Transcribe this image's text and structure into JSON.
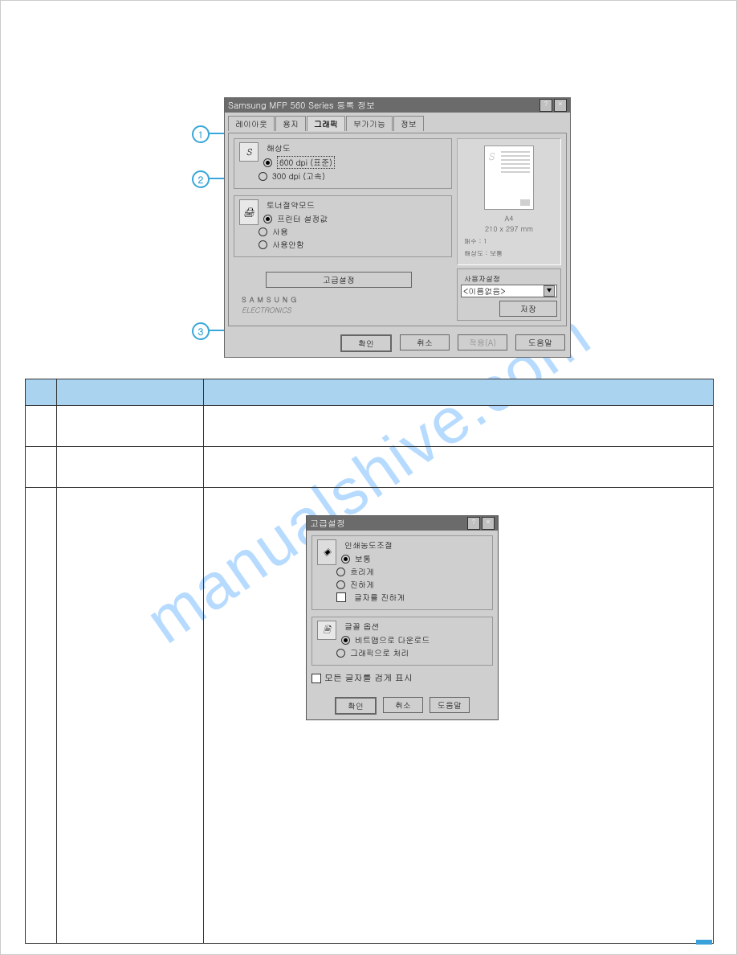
{
  "watermark": "manualshive.com",
  "dialog1": {
    "title": "Samsung MFP 560 Series 등록 정보",
    "tabs": [
      "레이아웃",
      "용지",
      "그래픽",
      "부가기능",
      "정보"
    ],
    "active_tab": 2,
    "resolution": {
      "legend": "해상도",
      "opt1": "600 dpi (표준)",
      "opt2": "300 dpi (고속)"
    },
    "toner": {
      "legend": "토너절약모드",
      "opt1": "프린터 설정값",
      "opt2": "사용",
      "opt3": "사용안함"
    },
    "preview": {
      "paper": "A4",
      "size": "210 x 297 mm",
      "info1": "매수 : 1",
      "info2": "해상도 : 보통"
    },
    "userset": {
      "legend": "사용자설정",
      "combo": "<이름없음>",
      "save": "저장"
    },
    "advanced_btn": "고급설정",
    "brand_top": "SAMSUNG",
    "brand_sub": "ELECTRONICS",
    "buttons": {
      "ok": "확인",
      "cancel": "취소",
      "apply": "적용(A)",
      "help": "도움말"
    }
  },
  "callouts": {
    "c1": "1",
    "c2": "2",
    "c3": "3"
  },
  "dialog2": {
    "title": "고급설정",
    "darkness": {
      "legend": "인쇄농도조절",
      "opt1": "보통",
      "opt2": "흐리게",
      "opt3": "진하게",
      "chk": "글자를 진하게"
    },
    "font": {
      "legend": "글꼴 옵션",
      "opt1": "비트맵으로 다운로드",
      "opt2": "그래픽으로 처리"
    },
    "allblack": "모든 글자를 검게 표시",
    "buttons": {
      "ok": "확인",
      "cancel": "취소",
      "help": "도움말"
    }
  }
}
